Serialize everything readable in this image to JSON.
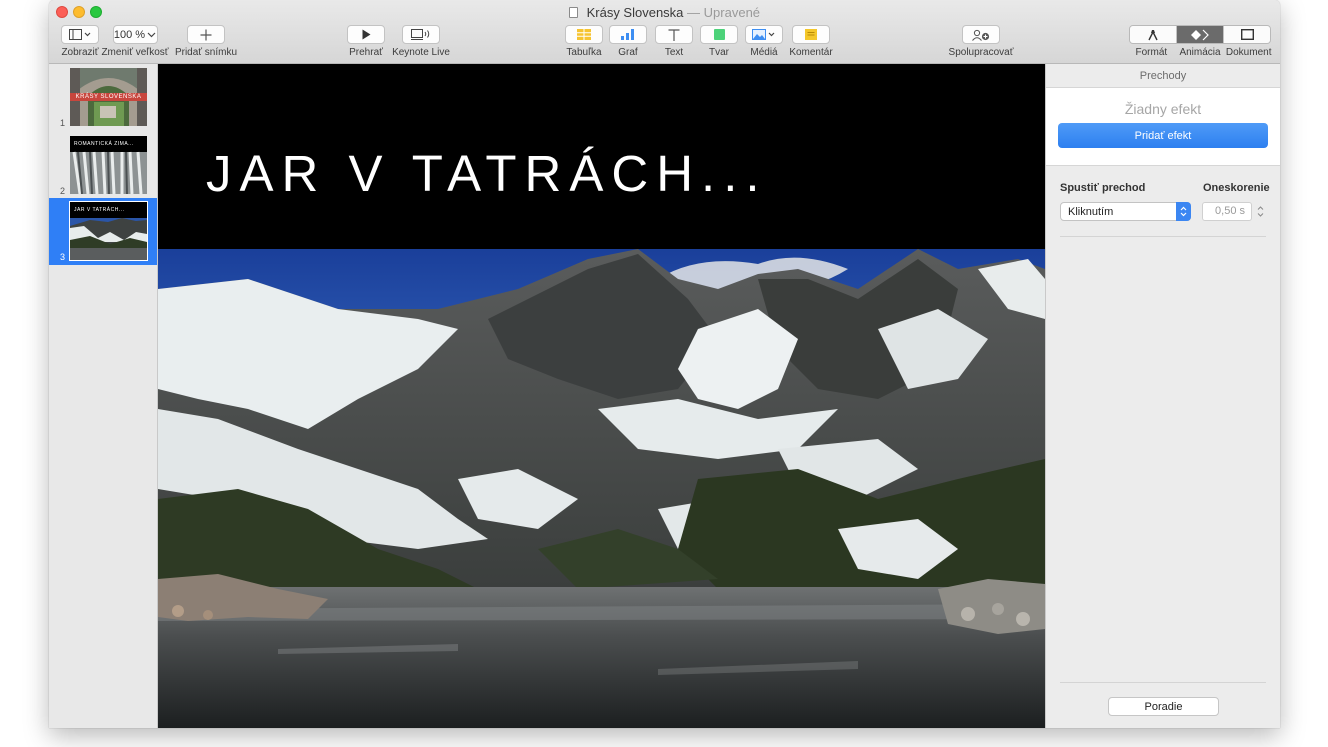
{
  "window": {
    "title": "Krásy Slovenska",
    "title_suffix": "— Upravené"
  },
  "toolbar": {
    "view_label": "Zobraziť",
    "zoom_value": "100 %",
    "zoom_label": "Zmeniť veľkosť",
    "add_slide_label": "Pridať snímku",
    "play_label": "Prehrať",
    "keynote_live_label": "Keynote Live",
    "table_label": "Tabuľka",
    "chart_label": "Graf",
    "text_label": "Text",
    "shape_label": "Tvar",
    "media_label": "Médiá",
    "comment_label": "Komentár",
    "collaborate_label": "Spolupracovať",
    "format_label": "Formát",
    "animate_label": "Animácia",
    "document_label": "Dokument"
  },
  "sidebar": {
    "slides": [
      {
        "number": "1",
        "title": "KRÁSY SLOVENSKA"
      },
      {
        "number": "2",
        "title": "ROMANTICKÁ ZIMA..."
      },
      {
        "number": "3",
        "title": "JAR V TATRÁCH..."
      }
    ]
  },
  "slide": {
    "title": "JAR V TATRÁCH..."
  },
  "inspector": {
    "tab": "Prechody",
    "no_effect": "Žiadny efekt",
    "add_effect": "Pridať efekt",
    "start_transition_label": "Spustiť prechod",
    "start_transition_value": "Kliknutím",
    "delay_label": "Oneskorenie",
    "delay_value": "0,50 s",
    "order_button": "Poradie"
  },
  "colors": {
    "accent": "#2f7ff6",
    "close": "#fc5f57",
    "minimize": "#fdbc2e",
    "maximize": "#29c840",
    "red_banner": "#c8463d"
  },
  "icons": {
    "view": "sidebar-view-icon",
    "add_slide": "plus-icon",
    "play": "play-icon",
    "keynote_live": "keynote-live-icon",
    "table": "table-icon",
    "chart": "chart-icon",
    "text": "text-icon",
    "shape": "shape-icon",
    "media": "media-icon",
    "comment": "comment-icon",
    "collaborate": "collaborate-icon",
    "format": "paintbrush-icon",
    "animate": "diamond-icon",
    "document": "document-icon"
  }
}
